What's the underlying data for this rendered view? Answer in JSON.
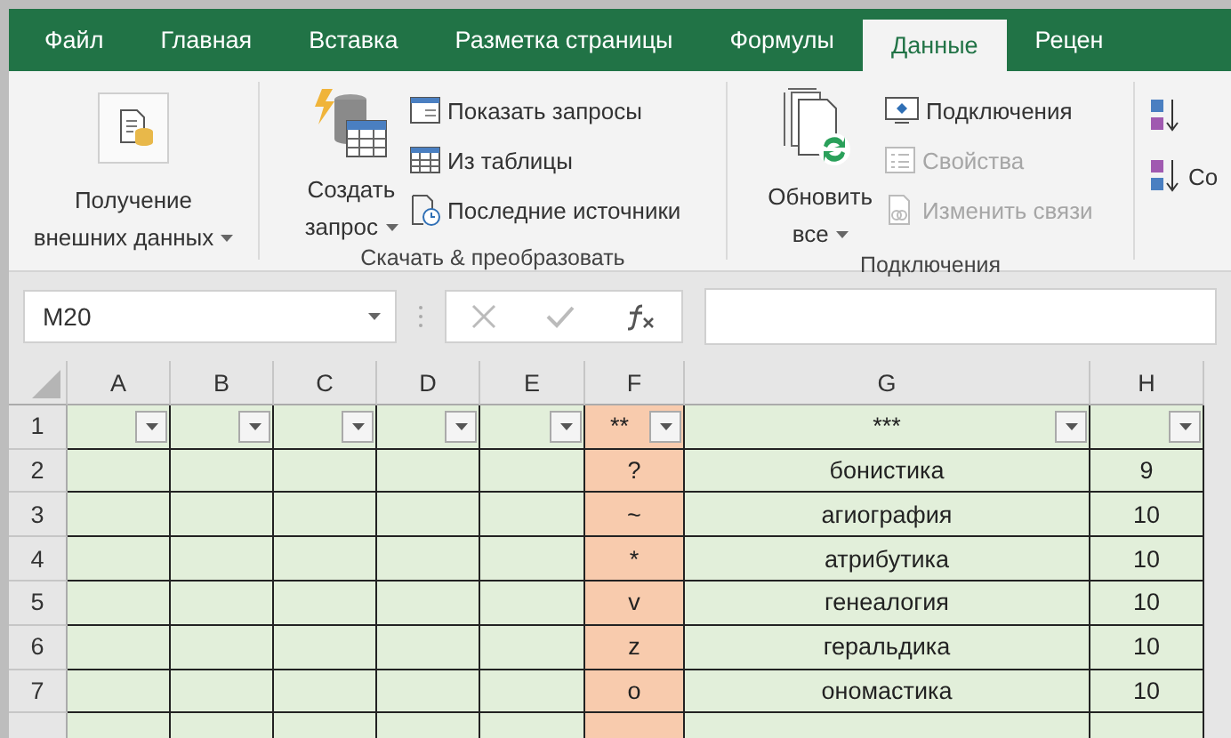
{
  "tabs": [
    {
      "label": "Файл",
      "selected": false
    },
    {
      "label": "Главная",
      "selected": false
    },
    {
      "label": "Вставка",
      "selected": false
    },
    {
      "label": "Разметка страницы",
      "selected": false
    },
    {
      "label": "Формулы",
      "selected": false
    },
    {
      "label": "Данные",
      "selected": true
    },
    {
      "label": "Рецен",
      "selected": false
    }
  ],
  "ribbon": {
    "get_data": {
      "label_line1": "Получение",
      "label_line2": "внешних данных"
    },
    "transform_group": {
      "title": "Скачать & преобразовать",
      "create_query": {
        "label_line1": "Создать",
        "label_line2": "запрос"
      },
      "items": [
        {
          "label": "Показать запросы",
          "disabled": false,
          "kind": "queries"
        },
        {
          "label": "Из таблицы",
          "disabled": false,
          "kind": "table"
        },
        {
          "label": "Последние источники",
          "disabled": false,
          "kind": "recent"
        }
      ]
    },
    "connections_group": {
      "title": "Подключения",
      "refresh": {
        "label_line1": "Обновить",
        "label_line2": "все"
      },
      "items": [
        {
          "label": "Подключения",
          "disabled": false,
          "kind": "connections"
        },
        {
          "label": "Свойства",
          "disabled": true,
          "kind": "properties"
        },
        {
          "label": "Изменить связи",
          "disabled": true,
          "kind": "links"
        }
      ]
    },
    "sort_group": {
      "sort_label": "Со"
    }
  },
  "name_box": {
    "value": "M20"
  },
  "columns": [
    {
      "letter": "A",
      "color": "#e2efda",
      "filter": true
    },
    {
      "letter": "B",
      "color": "#e2efda",
      "filter": true
    },
    {
      "letter": "C",
      "color": "#e2efda",
      "filter": true
    },
    {
      "letter": "D",
      "color": "#e2efda",
      "filter": true
    },
    {
      "letter": "E",
      "color": "#e2efda",
      "filter": true
    },
    {
      "letter": "F",
      "color": "#f8cbad",
      "filter": true
    },
    {
      "letter": "G",
      "color": "#e2efda",
      "filter": true
    },
    {
      "letter": "H",
      "color": "#e2efda",
      "filter": true
    }
  ],
  "rows": [
    {
      "number": "1",
      "f": "**",
      "g": "***"
    },
    {
      "number": "2",
      "f": "?",
      "g": "бонистика",
      "h": "9"
    },
    {
      "number": "3",
      "f": "~",
      "g": "агиография",
      "h": "10"
    },
    {
      "number": "4",
      "f": "*",
      "g": "атрибутика",
      "h": "10"
    },
    {
      "number": "5",
      "f": "v",
      "g": "генеалогия",
      "h": "10"
    },
    {
      "number": "6",
      "f": "z",
      "g": "геральдика",
      "h": "10"
    },
    {
      "number": "7",
      "f": "o",
      "g": "ономастика",
      "h": "10"
    }
  ]
}
